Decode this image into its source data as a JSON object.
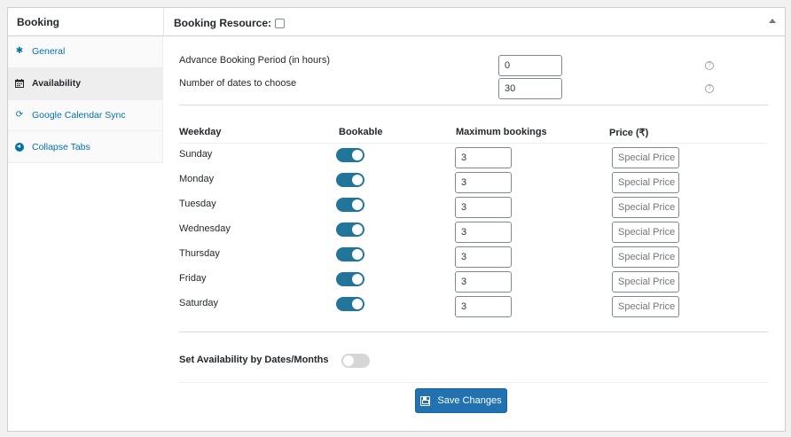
{
  "panel": {
    "title": "Booking"
  },
  "header": {
    "resource_label": "Booking Resource:"
  },
  "sidebar": {
    "tabs": [
      {
        "label": "General",
        "icon": "gear-icon"
      },
      {
        "label": "Availability",
        "icon": "calendar-icon"
      },
      {
        "label": "Google Calendar Sync",
        "icon": "sync-icon"
      },
      {
        "label": "Collapse Tabs",
        "icon": "collapse-arrow-icon"
      }
    ]
  },
  "settings": {
    "advance_label": "Advance Booking Period (in hours)",
    "advance_value": "0",
    "dates_label": "Number of dates to choose",
    "dates_value": "30",
    "help_glyph": "?"
  },
  "weekdays": {
    "headers": {
      "weekday": "Weekday",
      "bookable": "Bookable",
      "max": "Maximum bookings",
      "price": "Price (₹)"
    },
    "price_placeholder": "Special Price",
    "rows": [
      {
        "day": "Sunday",
        "bookable": true,
        "max": "3"
      },
      {
        "day": "Monday",
        "bookable": true,
        "max": "3"
      },
      {
        "day": "Tuesday",
        "bookable": true,
        "max": "3"
      },
      {
        "day": "Wednesday",
        "bookable": true,
        "max": "3"
      },
      {
        "day": "Thursday",
        "bookable": true,
        "max": "3"
      },
      {
        "day": "Friday",
        "bookable": true,
        "max": "3"
      },
      {
        "day": "Saturday",
        "bookable": true,
        "max": "3"
      }
    ]
  },
  "availability": {
    "label": "Set Availability by Dates/Months",
    "enabled": false
  },
  "actions": {
    "save_label": "Save Changes"
  },
  "colors": {
    "accent": "#2271b1",
    "toggle_on": "#21759b",
    "toggle_off": "#d6d6d6",
    "link": "#0073aa"
  }
}
